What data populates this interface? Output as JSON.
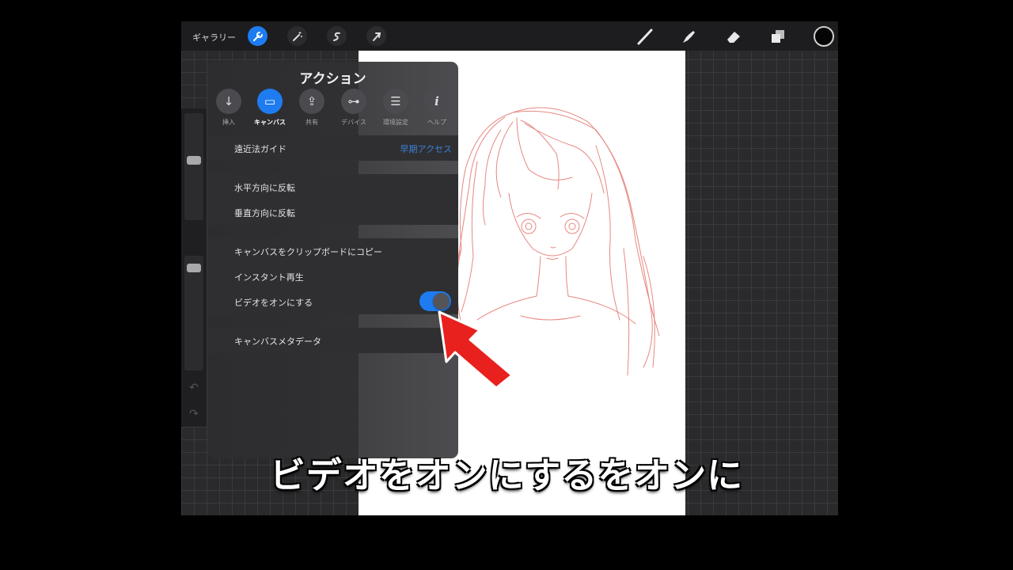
{
  "topbar": {
    "gallery_label": "ギャラリー",
    "left_icons": [
      "wrench-icon",
      "magic-wand-icon",
      "selection-icon",
      "transform-arrow-icon"
    ],
    "right_tools": [
      "brush-icon",
      "smudge-icon",
      "eraser-icon",
      "layers-icon"
    ],
    "current_color": "#050505"
  },
  "panel": {
    "title": "アクション",
    "tabs": [
      {
        "label": "挿入",
        "icon": "download-arrow-icon",
        "glyph": "↓"
      },
      {
        "label": "キャンバス",
        "icon": "canvas-rectangle-icon",
        "glyph": "▭",
        "active": true
      },
      {
        "label": "共有",
        "icon": "share-icon",
        "glyph": "⇪"
      },
      {
        "label": "デバイス",
        "icon": "link-icon",
        "glyph": "⊶"
      },
      {
        "label": "環境設定",
        "icon": "list-icon",
        "glyph": "☰"
      },
      {
        "label": "ヘルプ",
        "icon": "info-icon",
        "glyph": "i"
      }
    ],
    "rows": {
      "perspective_guide": "遠近法ガイド",
      "early_access": "早期アクセス",
      "flip_horizontal": "水平方向に反転",
      "flip_vertical": "垂直方向に反転",
      "copy_canvas": "キャンバスをクリップボードにコピー",
      "instant_play": "インスタント再生",
      "video_on": "ビデオをオンにする",
      "canvas_metadata": "キャンバスメタデータ"
    },
    "video_toggle_on": true
  },
  "caption": "ビデオをオンにするをオンに",
  "colors": {
    "accent": "#1e7cf0",
    "annotation_arrow": "#e8201e",
    "sketch_line": "#e06a62"
  }
}
